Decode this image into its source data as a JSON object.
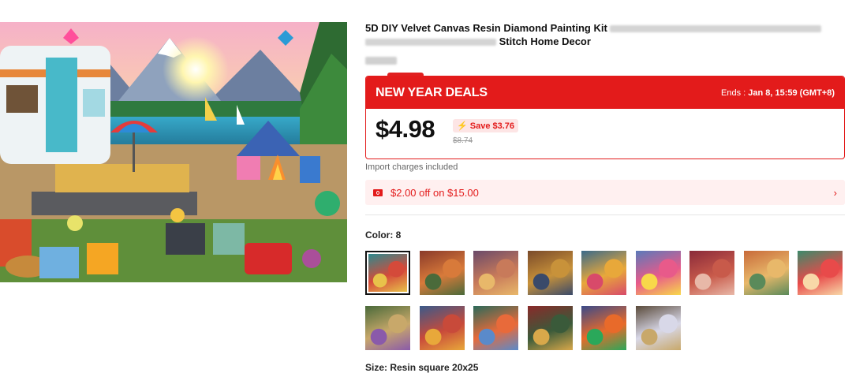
{
  "product": {
    "title_part1": "5D DIY Velvet Canvas Resin Diamond Painting Kit",
    "title_part2": "Stitch Home Decor"
  },
  "deal": {
    "title": "NEW YEAR DEALS",
    "ends_label": "Ends : ",
    "ends_value": "Jan 8, 15:59 (GMT+8)",
    "price": "$4.98",
    "save": "Save $3.76",
    "original_price": "$8.74"
  },
  "import_note": "Import charges included",
  "coupon": {
    "text": "$2.00 off on $15.00",
    "chevron": "›"
  },
  "color": {
    "label": "Color: 8",
    "swatch_palettes": [
      [
        "#2c8a8e",
        "#d44a3a",
        "#e8c24a"
      ],
      [
        "#8a3a2a",
        "#d87a3a",
        "#4a6a3a"
      ],
      [
        "#6a4a6a",
        "#c87a5a",
        "#e8b86a"
      ],
      [
        "#7a4a2a",
        "#c8923a",
        "#3a4a6a"
      ],
      [
        "#3a6a8a",
        "#e8a83a",
        "#d84a6a"
      ],
      [
        "#5a7aba",
        "#e85a8a",
        "#f8d84a"
      ],
      [
        "#8a2a3a",
        "#c85a4a",
        "#e8b8a8"
      ],
      [
        "#c86a3a",
        "#e8b86a",
        "#5a8a5a"
      ],
      [
        "#3a8a6a",
        "#e84a4a",
        "#f8d8a8"
      ],
      [
        "#4a6a3a",
        "#c8a86a",
        "#8a5aaa"
      ],
      [
        "#3a5a8a",
        "#c84a3a",
        "#e8a83a"
      ],
      [
        "#2a6a5a",
        "#e86a3a",
        "#5a8aca"
      ],
      [
        "#8a2a2a",
        "#3a5a3a",
        "#d8a84a"
      ],
      [
        "#3a4a8a",
        "#e86a2a",
        "#2aa85a"
      ],
      [
        "#5a4a3a",
        "#d8d8e8",
        "#c8a86a"
      ]
    ]
  },
  "size": {
    "label": "Size: Resin square 20x25"
  }
}
